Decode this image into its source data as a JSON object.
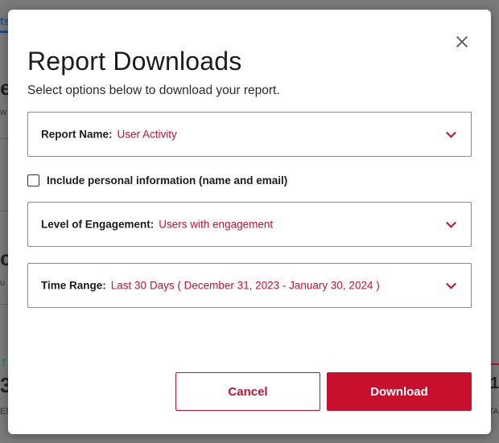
{
  "background": {
    "tab_fragment": "ts",
    "big_fragment_1": "e",
    "small_fragment_1": "w",
    "big_fragment_2": "ct",
    "small_fragment_2": "u",
    "arrow_fragment": "↑",
    "number_fragment": "3",
    "label_fragment": "EN",
    "right_number_fragment": "1",
    "right_label_fragment": "TA"
  },
  "modal": {
    "title": "Report Downloads",
    "subtitle": "Select options below to download your report.",
    "report_name": {
      "label": "Report Name:",
      "value": "User Activity"
    },
    "include_personal": {
      "label": "Include personal information (name and email)",
      "checked": false
    },
    "engagement": {
      "label": "Level of Engagement:",
      "value": "Users with engagement"
    },
    "time_range": {
      "label": "Time Range:",
      "value": "Last 30 Days ( December 31, 2023 - January 30, 2024 )"
    },
    "cancel_label": "Cancel",
    "download_label": "Download"
  },
  "colors": {
    "accent": "#c8102e",
    "overlay": "#7a7a7a"
  }
}
